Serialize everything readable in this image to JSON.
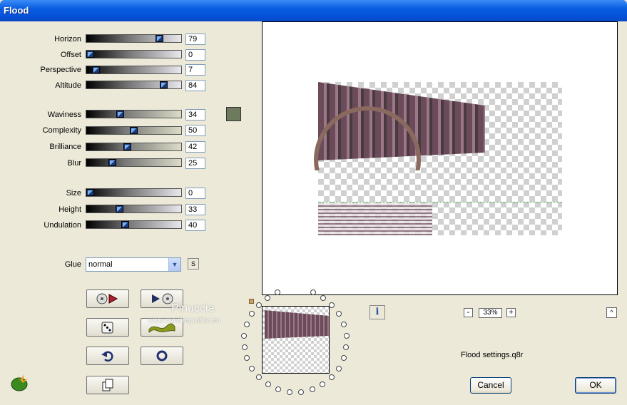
{
  "window": {
    "title": "Flood"
  },
  "params_group1": [
    {
      "label": "Horizon",
      "value": "79",
      "slider_fraction": 0.79
    },
    {
      "label": "Offset",
      "value": "0",
      "slider_fraction": 0.0
    },
    {
      "label": "Perspective",
      "value": "7",
      "slider_fraction": 0.07
    },
    {
      "label": "Altitude",
      "value": "84",
      "slider_fraction": 0.84
    }
  ],
  "params_group2": [
    {
      "label": "Waviness",
      "value": "34",
      "slider_fraction": 0.34
    },
    {
      "label": "Complexity",
      "value": "50",
      "slider_fraction": 0.5
    },
    {
      "label": "Brilliance",
      "value": "42",
      "slider_fraction": 0.42
    },
    {
      "label": "Blur",
      "value": "25",
      "slider_fraction": 0.25
    }
  ],
  "params_group3": [
    {
      "label": "Size",
      "value": "0",
      "slider_fraction": 0.0
    },
    {
      "label": "Height",
      "value": "33",
      "slider_fraction": 0.33
    },
    {
      "label": "Undulation",
      "value": "40",
      "slider_fraction": 0.4
    }
  ],
  "color_swatch": "#6e7a5e",
  "glue": {
    "label": "Glue",
    "value": "normal",
    "s_button": "S"
  },
  "zoom": {
    "value": "33%",
    "minus": "-",
    "plus": "+"
  },
  "filename": "Flood settings.q8r",
  "buttons": {
    "ok": "OK",
    "cancel": "Cancel"
  },
  "watermark": {
    "line1": "Pinuccia",
    "line2": "www.maidiregrafica.eu"
  }
}
